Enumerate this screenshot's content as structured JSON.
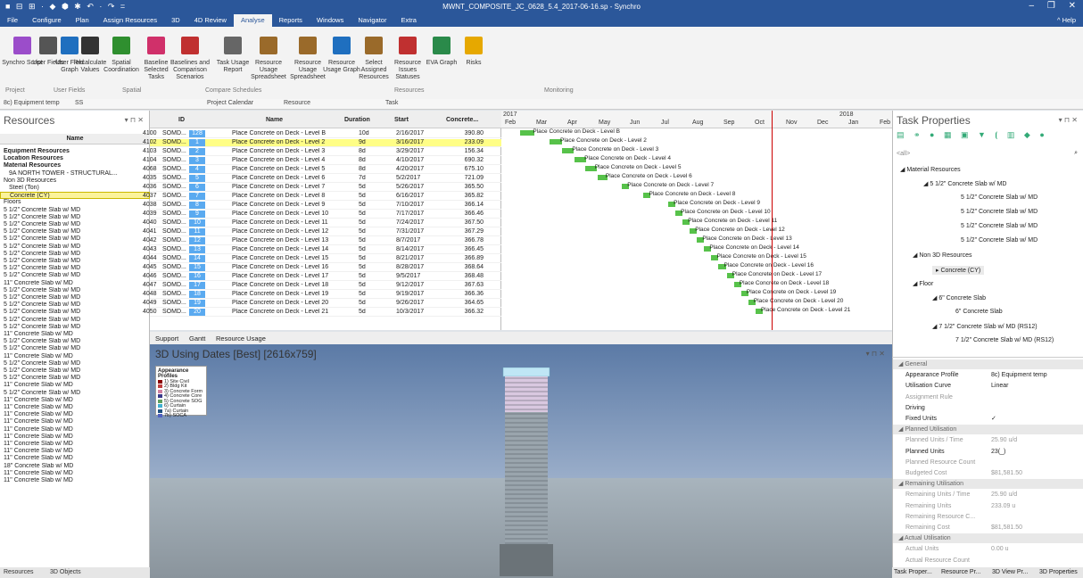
{
  "window": {
    "title": "MWNT_COMPOSITE_JC_0628_5.4_2017-06-16.sp - Synchro"
  },
  "menu": [
    "File",
    "Configure",
    "Plan",
    "Assign Resources",
    "3D",
    "4D Review",
    "Analyse",
    "Reports",
    "Windows",
    "Navigator",
    "Extra"
  ],
  "menu_help": "^ Help",
  "ribbon": {
    "buttons": [
      "Synchro Script",
      "User Fields",
      "User Field Graph",
      "Recalculate Values",
      "Spatial Coordination",
      "Baseline Selected Tasks",
      "Baselines and Comparison Scenarios",
      "Task Usage Report",
      "Resource Usage Spreadsheet",
      "Resource Usage Spreadsheet",
      "Resource Usage Graph",
      "Select Assigned Resources",
      "Resource Issues Statuses",
      "EVA Graph",
      "Risks"
    ],
    "groups": [
      "Project",
      "User Fields",
      "Spatial",
      "Compare Schedules",
      "Resources",
      "Monitoring"
    ]
  },
  "filterbar": {
    "profile": "8c) Equipment temp",
    "ss": "SS",
    "calendar": "Project Calendar",
    "resource": "Resource",
    "task": "Task"
  },
  "resources": {
    "title": "Resources",
    "col": "Name",
    "rows": [
      "Equipment Resources",
      "Location Resources",
      "Material Resources",
      "9A NORTH TOWER - STRUCTURAL...",
      "Non 3D Resources",
      "Steel (Ton)",
      "Concrete (CY)",
      "Floors",
      "5 1/2\" Concrete Slab w/ MD",
      "5 1/2\" Concrete Slab w/ MD",
      "5 1/2\" Concrete Slab w/ MD",
      "5 1/2\" Concrete Slab w/ MD",
      "5 1/2\" Concrete Slab w/ MD",
      "5 1/2\" Concrete Slab w/ MD",
      "5 1/2\" Concrete Slab w/ MD",
      "5 1/2\" Concrete Slab w/ MD",
      "5 1/2\" Concrete Slab w/ MD",
      "5 1/2\" Concrete Slab w/ MD",
      "11\" Concrete Slab w/ MD",
      "5 1/2\" Concrete Slab w/ MD",
      "5 1/2\" Concrete Slab w/ MD",
      "5 1/2\" Concrete Slab w/ MD",
      "5 1/2\" Concrete Slab w/ MD",
      "5 1/2\" Concrete Slab w/ MD",
      "5 1/2\" Concrete Slab w/ MD",
      "11\" Concrete Slab w/ MD",
      "5 1/2\" Concrete Slab w/ MD",
      "5 1/2\" Concrete Slab w/ MD",
      "11\" Concrete Slab w/ MD",
      "5 1/2\" Concrete Slab w/ MD",
      "5 1/2\" Concrete Slab w/ MD",
      "5 1/2\" Concrete Slab w/ MD",
      "11\" Concrete Slab w/ MD",
      "5 1/2\" Concrete Slab w/ MD",
      "11\" Concrete Slab w/ MD",
      "11\" Concrete Slab w/ MD",
      "11\" Concrete Slab w/ MD",
      "11\" Concrete Slab w/ MD",
      "11\" Concrete Slab w/ MD",
      "11\" Concrete Slab w/ MD",
      "11\" Concrete Slab w/ MD",
      "11\" Concrete Slab w/ MD",
      "11\" Concrete Slab w/ MD",
      "18\" Concrete Slab w/ MD",
      "11\" Concrete Slab w/ MD",
      "11\" Concrete Slab w/ MD"
    ],
    "tabs": [
      "Resources",
      "3D Objects"
    ]
  },
  "grid": {
    "headers": [
      "ID",
      "Name",
      "Duration",
      "Start",
      "Concrete..."
    ],
    "rows": [
      {
        "id": "4100",
        "code": "SOMD...",
        "n": "128",
        "name": "Place Concrete on Deck - Level B",
        "dur": "10d",
        "start": "2/16/2017",
        "val": "390.80"
      },
      {
        "id": "4102",
        "code": "SOMD...",
        "n": "1",
        "name": "Place Concrete on Deck - Level 2",
        "dur": "9d",
        "start": "3/16/2017",
        "val": "233.09"
      },
      {
        "id": "4103",
        "code": "SOMD...",
        "n": "2",
        "name": "Place Concrete on Deck - Level 3",
        "dur": "8d",
        "start": "3/29/2017",
        "val": "156.34"
      },
      {
        "id": "4104",
        "code": "SOMD...",
        "n": "3",
        "name": "Place Concrete on Deck - Level 4",
        "dur": "8d",
        "start": "4/10/2017",
        "val": "690.32"
      },
      {
        "id": "4068",
        "code": "SOMD...",
        "n": "4",
        "name": "Place Concrete on Deck - Level 5",
        "dur": "8d",
        "start": "4/20/2017",
        "val": "675.10"
      },
      {
        "id": "4035",
        "code": "SOMD...",
        "n": "5",
        "name": "Place Concrete on Deck - Level 6",
        "dur": "7d",
        "start": "5/2/2017",
        "val": "721.09"
      },
      {
        "id": "4036",
        "code": "SOMD...",
        "n": "6",
        "name": "Place Concrete on Deck - Level 7",
        "dur": "5d",
        "start": "5/26/2017",
        "val": "365.50"
      },
      {
        "id": "4037",
        "code": "SOMD...",
        "n": "7",
        "name": "Place Concrete on Deck - Level 8",
        "dur": "5d",
        "start": "6/16/2017",
        "val": "365.82"
      },
      {
        "id": "4038",
        "code": "SOMD...",
        "n": "8",
        "name": "Place Concrete on Deck - Level 9",
        "dur": "5d",
        "start": "7/10/2017",
        "val": "366.14"
      },
      {
        "id": "4039",
        "code": "SOMD...",
        "n": "9",
        "name": "Place Concrete on Deck - Level 10",
        "dur": "5d",
        "start": "7/17/2017",
        "val": "366.46"
      },
      {
        "id": "4040",
        "code": "SOMD...",
        "n": "10",
        "name": "Place Concrete on Deck - Level 11",
        "dur": "5d",
        "start": "7/24/2017",
        "val": "367.50"
      },
      {
        "id": "4041",
        "code": "SOMD...",
        "n": "11",
        "name": "Place Concrete on Deck - Level 12",
        "dur": "5d",
        "start": "7/31/2017",
        "val": "367.29"
      },
      {
        "id": "4042",
        "code": "SOMD...",
        "n": "12",
        "name": "Place Concrete on Deck - Level 13",
        "dur": "5d",
        "start": "8/7/2017",
        "val": "366.78"
      },
      {
        "id": "4043",
        "code": "SOMD...",
        "n": "13",
        "name": "Place Concrete on Deck - Level 14",
        "dur": "5d",
        "start": "8/14/2017",
        "val": "366.45"
      },
      {
        "id": "4044",
        "code": "SOMD...",
        "n": "14",
        "name": "Place Concrete on Deck - Level 15",
        "dur": "5d",
        "start": "8/21/2017",
        "val": "366.89"
      },
      {
        "id": "4045",
        "code": "SOMD...",
        "n": "15",
        "name": "Place Concrete on Deck - Level 16",
        "dur": "5d",
        "start": "8/28/2017",
        "val": "368.64"
      },
      {
        "id": "4046",
        "code": "SOMD...",
        "n": "16",
        "name": "Place Concrete on Deck - Level 17",
        "dur": "5d",
        "start": "9/5/2017",
        "val": "368.48"
      },
      {
        "id": "4047",
        "code": "SOMD...",
        "n": "17",
        "name": "Place Concrete on Deck - Level 18",
        "dur": "5d",
        "start": "9/12/2017",
        "val": "367.63"
      },
      {
        "id": "4048",
        "code": "SOMD...",
        "n": "18",
        "name": "Place Concrete on Deck - Level 19",
        "dur": "5d",
        "start": "9/19/2017",
        "val": "366.36"
      },
      {
        "id": "4049",
        "code": "SOMD...",
        "n": "19",
        "name": "Place Concrete on Deck - Level 20",
        "dur": "5d",
        "start": "9/26/2017",
        "val": "364.65"
      },
      {
        "id": "4050",
        "code": "SOMD...",
        "n": "20",
        "name": "Place Concrete on Deck - Level 21",
        "dur": "5d",
        "start": "10/3/2017",
        "val": "366.32"
      }
    ]
  },
  "gantt": {
    "years": [
      "2017",
      "2018"
    ],
    "months": [
      "Feb",
      "Mar",
      "Apr",
      "May",
      "Jun",
      "Jul",
      "Aug",
      "Sep",
      "Oct",
      "Nov",
      "Dec",
      "Jan",
      "Feb"
    ],
    "labels": [
      "Place Concrete on Deck - Level B",
      "Place Concrete on Deck - Level 2",
      "Place Concrete on Deck - Level 3",
      "Place Concrete on Deck - Level 4",
      "Place Concrete on Deck - Level 5",
      "Place Concrete on Deck - Level 6",
      "Place Concrete on Deck - Level 7",
      "Place Concrete on Deck - Level 8",
      "Place Concrete on Deck - Level 9",
      "Place Concrete on Deck - Level 10",
      "Place Concrete on Deck - Level 11",
      "Place Concrete on Deck - Level 12",
      "Place Concrete on Deck - Level 13",
      "Place Concrete on Deck - Level 14",
      "Place Concrete on Deck - Level 15",
      "Place Concrete on Deck - Level 16",
      "Place Concrete on Deck - Level 17",
      "Place Concrete on Deck - Level 18",
      "Place Concrete on Deck - Level 19",
      "Place Concrete on Deck - Level 20",
      "Place Concrete on Deck - Level 21"
    ]
  },
  "midtabs": [
    "Support",
    "Gantt",
    "Resource Usage"
  ],
  "view3d": {
    "title": "3D Using Dates [Best] [2616x759]",
    "legend_title": "Appearance Profiles",
    "legend": [
      "1) Site Civil",
      "2) Bldg Kit",
      "3) Concrete Form",
      "4) Concrete Core",
      "5) Concrete SOG",
      "6) Curtain",
      "7a) Curtain",
      "7b) SOCA"
    ],
    "legend_colors": [
      "#8b0000",
      "#c04040",
      "#d080a0",
      "#3a3a8a",
      "#60a060",
      "#40b0d0",
      "#205080",
      "#5060c0"
    ]
  },
  "taskprops": {
    "title": "Task Properties",
    "search": "<all>",
    "tree": [
      {
        "indent": 4,
        "text": "◢  Material Resources"
      },
      {
        "indent": 30,
        "text": "◢  5 1/2\" Concrete Slab w/ MD"
      },
      {
        "indent": 72,
        "text": "5 1/2\" Concrete Slab w/ MD"
      },
      {
        "indent": 72,
        "text": "5 1/2\" Concrete Slab w/ MD"
      },
      {
        "indent": 72,
        "text": "5 1/2\" Concrete Slab w/ MD"
      },
      {
        "indent": 72,
        "text": "5 1/2\" Concrete Slab w/ MD"
      },
      {
        "indent": 18,
        "text": "◢  Non 3D Resources"
      },
      {
        "indent": 40,
        "text": "▸  Concrete (CY)"
      },
      {
        "indent": 18,
        "text": "◢  Floor"
      },
      {
        "indent": 40,
        "text": "◢  6\" Concrete Slab"
      },
      {
        "indent": 66,
        "text": "6\" Concrete Slab"
      },
      {
        "indent": 40,
        "text": "◢  7 1/2\" Concrete Slab w/ MD (RS12)"
      },
      {
        "indent": 66,
        "text": "7 1/2\" Concrete Slab w/ MD (RS12)"
      }
    ]
  },
  "props": [
    {
      "k": "◢ General",
      "v": "",
      "t": "sec"
    },
    {
      "k": "Appearance Profile",
      "v": "8c) Equipment temp",
      "t": ""
    },
    {
      "k": "Utilisation Curve",
      "v": "Linear",
      "t": ""
    },
    {
      "k": "Assignment Rule",
      "v": "",
      "t": "gray"
    },
    {
      "k": "Driving",
      "v": "",
      "t": ""
    },
    {
      "k": "Fixed Units",
      "v": "✓",
      "t": ""
    },
    {
      "k": "◢ Planned Utilisation",
      "v": "",
      "t": "sec"
    },
    {
      "k": "Planned Units / Time",
      "v": "25.90 u/d",
      "t": "gray"
    },
    {
      "k": "Planned Units",
      "v": "23(_)",
      "t": ""
    },
    {
      "k": "Planned Resource Count",
      "v": "",
      "t": "gray"
    },
    {
      "k": "Budgeted Cost",
      "v": "$81,581.50",
      "t": "gray"
    },
    {
      "k": "◢ Remaining Utilisation",
      "v": "",
      "t": "sec"
    },
    {
      "k": "Remaining Units / Time",
      "v": "25.90 u/d",
      "t": "gray"
    },
    {
      "k": "Remaining Units",
      "v": "233.09 u",
      "t": "gray"
    },
    {
      "k": "Remaining Resource C...",
      "v": "",
      "t": "gray"
    },
    {
      "k": "Remaining Cost",
      "v": "$81,581.50",
      "t": "gray"
    },
    {
      "k": "◢ Actual Utilisation",
      "v": "",
      "t": "sec"
    },
    {
      "k": "Actual Units",
      "v": "0.00 u",
      "t": "gray"
    },
    {
      "k": "Actual Resource Count",
      "v": "",
      "t": "gray"
    }
  ],
  "right_tabs": [
    "Task Proper...",
    "Resource Pr...",
    "3D View Pr...",
    "3D Properties"
  ]
}
